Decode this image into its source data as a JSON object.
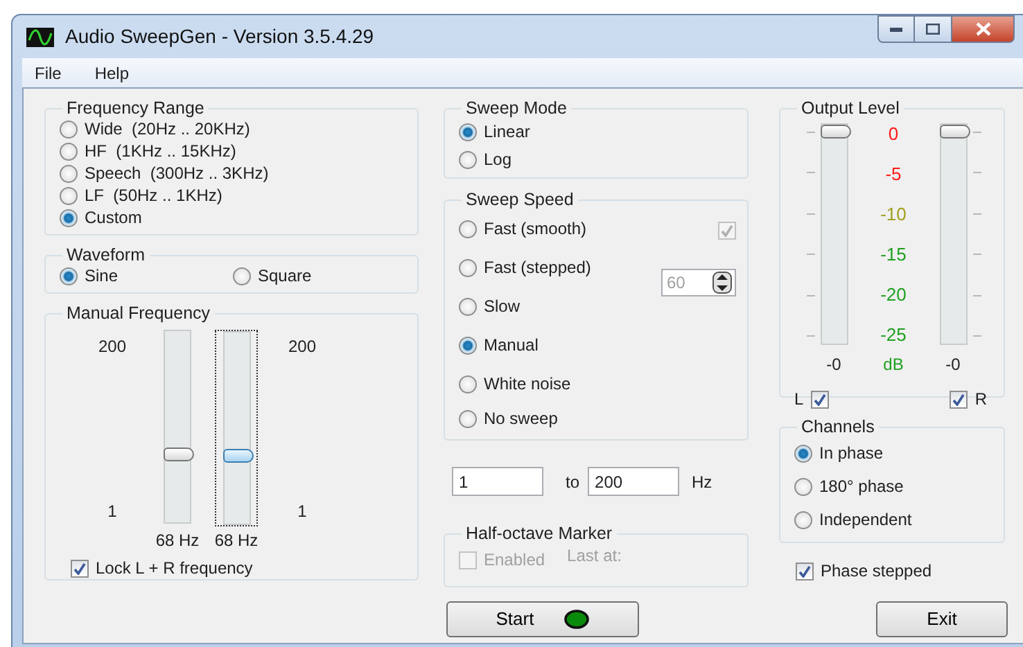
{
  "window": {
    "title": "Audio SweepGen - Version 3.5.4.29"
  },
  "menu": [
    "File",
    "Help"
  ],
  "frequency_range": {
    "title": "Frequency Range",
    "options": [
      {
        "label": "Wide  (20Hz .. 20KHz)",
        "selected": false
      },
      {
        "label": "HF  (1KHz .. 15KHz)",
        "selected": false
      },
      {
        "label": "Speech  (300Hz .. 3KHz)",
        "selected": false
      },
      {
        "label": "LF  (50Hz .. 1KHz)",
        "selected": false
      },
      {
        "label": "Custom",
        "selected": true
      }
    ]
  },
  "waveform": {
    "title": "Waveform",
    "options": [
      {
        "label": "Sine",
        "selected": true
      },
      {
        "label": "Square",
        "selected": false
      }
    ]
  },
  "manual_frequency": {
    "title": "Manual Frequency",
    "sliders": [
      {
        "max": "200",
        "min": "1",
        "reading": "68 Hz",
        "level": 0.34,
        "focused": false
      },
      {
        "max": "200",
        "min": "1",
        "reading": "68 Hz",
        "level": 0.34,
        "focused": true
      }
    ],
    "lock": {
      "label": "Lock L + R frequency",
      "checked": true
    }
  },
  "sweep_mode": {
    "title": "Sweep Mode",
    "options": [
      {
        "label": "Linear",
        "selected": true
      },
      {
        "label": "Log",
        "selected": false
      }
    ]
  },
  "sweep_speed": {
    "title": "Sweep Speed",
    "options": [
      {
        "label": "Fast (smooth)",
        "selected": false
      },
      {
        "label": "Fast (stepped)",
        "selected": false
      },
      {
        "label": "Slow",
        "selected": false
      },
      {
        "label": "Manual",
        "selected": true
      },
      {
        "label": "White noise",
        "selected": false
      },
      {
        "label": "No sweep",
        "selected": false
      }
    ],
    "smooth_check": {
      "checked": true,
      "disabled": true
    },
    "step_spinner": {
      "value": "60",
      "disabled": true
    }
  },
  "frequency_limits": {
    "from": "1",
    "to_label": "to",
    "to": "200",
    "unit": "Hz"
  },
  "half_octave_marker": {
    "title": "Half-octave Marker",
    "enabled": {
      "label": "Enabled",
      "checked": false,
      "disabled": true
    },
    "last_at": "Last at:"
  },
  "output_level": {
    "title": "Output Level",
    "sliders": [
      {
        "level": 1,
        "reading": "-0"
      },
      {
        "level": 1,
        "reading": "-0"
      }
    ],
    "scale": [
      {
        "label": "0",
        "color": "#ff1a1a"
      },
      {
        "label": "-5",
        "color": "#ff1a1a"
      },
      {
        "label": "-10",
        "color": "#a0a020"
      },
      {
        "label": "-15",
        "color": "#20a020"
      },
      {
        "label": "-20",
        "color": "#20a020"
      },
      {
        "label": "-25",
        "color": "#20a020"
      }
    ],
    "unit": "dB",
    "left": {
      "label": "L",
      "checked": true
    },
    "right": {
      "label": "R",
      "checked": true
    }
  },
  "channels": {
    "title": "Channels",
    "options": [
      {
        "label": "In phase",
        "selected": true
      },
      {
        "label": "180° phase",
        "selected": false
      },
      {
        "label": "Independent",
        "selected": false
      }
    ]
  },
  "phase_stepped": {
    "label": "Phase stepped",
    "checked": true
  },
  "buttons": [
    {
      "label": "Start",
      "kind": "start"
    },
    {
      "label": "Exit",
      "kind": "exit"
    }
  ]
}
